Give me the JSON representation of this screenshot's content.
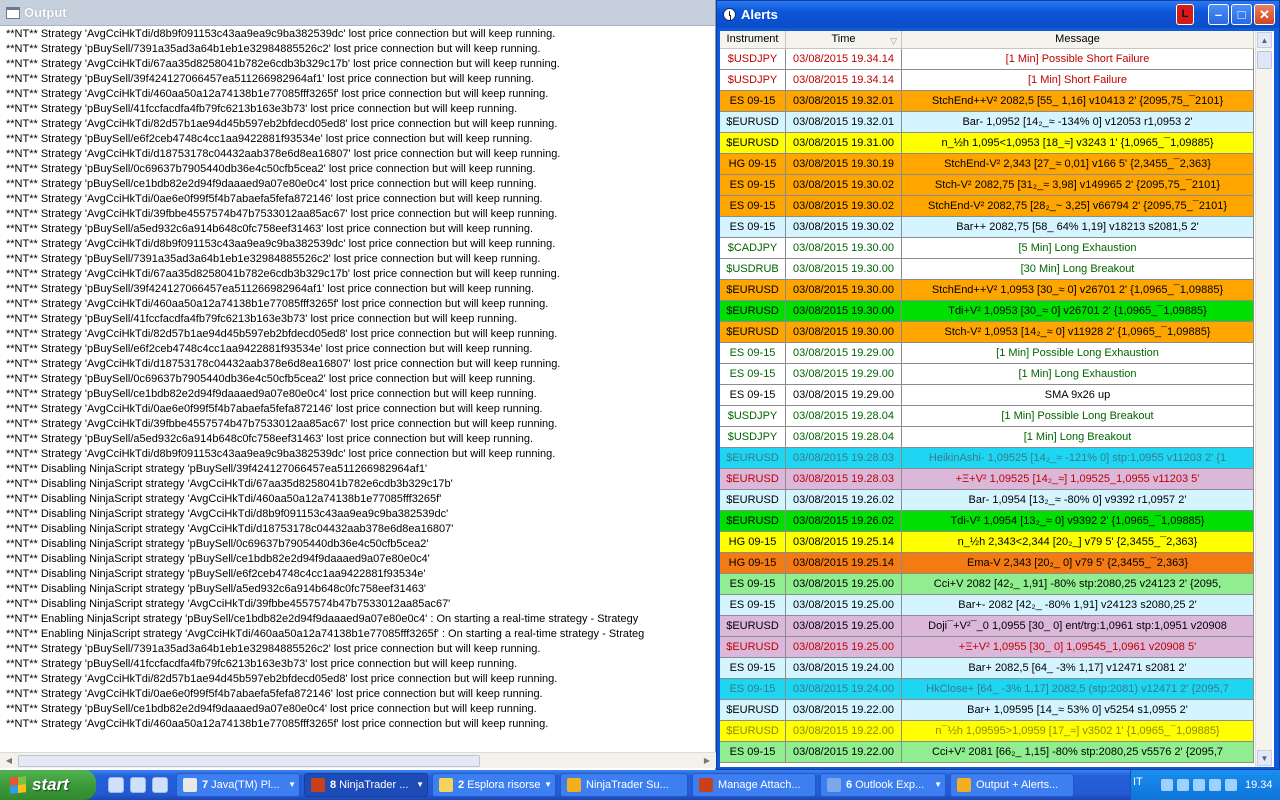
{
  "output": {
    "title": "Output",
    "lines": [
      "**NT** Strategy 'AvgCciHkTdi/d8b9f091153c43aa9ea9c9ba382539dc' lost price connection but will keep running.",
      "**NT** Strategy 'pBuySell/7391a35ad3a64b1eb1e32984885526c2' lost price connection but will keep running.",
      "**NT** Strategy 'AvgCciHkTdi/67aa35d8258041b782e6cdb3b329c17b' lost price connection but will keep running.",
      "**NT** Strategy 'pBuySell/39f424127066457ea511266982964af1' lost price connection but will keep running.",
      "**NT** Strategy 'AvgCciHkTdi/460aa50a12a74138b1e77085fff3265f' lost price connection but will keep running.",
      "**NT** Strategy 'pBuySell/41fccfacdfa4fb79fc6213b163e3b73' lost price connection but will keep running.",
      "**NT** Strategy 'AvgCciHkTdi/82d57b1ae94d45b597eb2bfdecd05ed8' lost price connection but will keep running.",
      "**NT** Strategy 'pBuySell/e6f2ceb4748c4cc1aa9422881f93534e' lost price connection but will keep running.",
      "**NT** Strategy 'AvgCciHkTdi/d18753178c04432aab378e6d8ea16807' lost price connection but will keep running.",
      "**NT** Strategy 'pBuySell/0c69637b7905440db36e4c50cfb5cea2' lost price connection but will keep running.",
      "**NT** Strategy 'pBuySell/ce1bdb82e2d94f9daaaed9a07e80e0c4' lost price connection but will keep running.",
      "**NT** Strategy 'AvgCciHkTdi/0ae6e0f99f5f4b7abaefa5fefa872146' lost price connection but will keep running.",
      "**NT** Strategy 'AvgCciHkTdi/39fbbe4557574b47b7533012aa85ac67' lost price connection but will keep running.",
      "**NT** Strategy 'pBuySell/a5ed932c6a914b648c0fc758eef31463' lost price connection but will keep running.",
      "**NT** Strategy 'AvgCciHkTdi/d8b9f091153c43aa9ea9c9ba382539dc' lost price connection but will keep running.",
      "**NT** Strategy 'pBuySell/7391a35ad3a64b1eb1e32984885526c2' lost price connection but will keep running.",
      "**NT** Strategy 'AvgCciHkTdi/67aa35d8258041b782e6cdb3b329c17b' lost price connection but will keep running.",
      "**NT** Strategy 'pBuySell/39f424127066457ea511266982964af1' lost price connection but will keep running.",
      "**NT** Strategy 'AvgCciHkTdi/460aa50a12a74138b1e77085fff3265f' lost price connection but will keep running.",
      "**NT** Strategy 'pBuySell/41fccfacdfa4fb79fc6213b163e3b73' lost price connection but will keep running.",
      "**NT** Strategy 'AvgCciHkTdi/82d57b1ae94d45b597eb2bfdecd05ed8' lost price connection but will keep running.",
      "**NT** Strategy 'pBuySell/e6f2ceb4748c4cc1aa9422881f93534e' lost price connection but will keep running.",
      "**NT** Strategy 'AvgCciHkTdi/d18753178c04432aab378e6d8ea16807' lost price connection but will keep running.",
      "**NT** Strategy 'pBuySell/0c69637b7905440db36e4c50cfb5cea2' lost price connection but will keep running.",
      "**NT** Strategy 'pBuySell/ce1bdb82e2d94f9daaaed9a07e80e0c4' lost price connection but will keep running.",
      "**NT** Strategy 'AvgCciHkTdi/0ae6e0f99f5f4b7abaefa5fefa872146' lost price connection but will keep running.",
      "**NT** Strategy 'AvgCciHkTdi/39fbbe4557574b47b7533012aa85ac67' lost price connection but will keep running.",
      "**NT** Strategy 'pBuySell/a5ed932c6a914b648c0fc758eef31463' lost price connection but will keep running.",
      "**NT** Strategy 'AvgCciHkTdi/d8b9f091153c43aa9ea9c9ba382539dc' lost price connection but will keep running.",
      "**NT** Disabling NinjaScript strategy 'pBuySell/39f424127066457ea511266982964af1'",
      "**NT** Disabling NinjaScript strategy 'AvgCciHkTdi/67aa35d8258041b782e6cdb3b329c17b'",
      "**NT** Disabling NinjaScript strategy 'AvgCciHkTdi/460aa50a12a74138b1e77085fff3265f'",
      "**NT** Disabling NinjaScript strategy 'AvgCciHkTdi/d8b9f091153c43aa9ea9c9ba382539dc'",
      "**NT** Disabling NinjaScript strategy 'AvgCciHkTdi/d18753178c04432aab378e6d8ea16807'",
      "**NT** Disabling NinjaScript strategy 'pBuySell/0c69637b7905440db36e4c50cfb5cea2'",
      "**NT** Disabling NinjaScript strategy 'pBuySell/ce1bdb82e2d94f9daaaed9a07e80e0c4'",
      "**NT** Disabling NinjaScript strategy 'pBuySell/e6f2ceb4748c4cc1aa9422881f93534e'",
      "**NT** Disabling NinjaScript strategy 'pBuySell/a5ed932c6a914b648c0fc758eef31463'",
      "**NT** Disabling NinjaScript strategy 'AvgCciHkTdi/39fbbe4557574b47b7533012aa85ac67'",
      "**NT** Enabling NinjaScript strategy 'pBuySell/ce1bdb82e2d94f9daaaed9a07e80e0c4' : On starting a real-time strategy - Strategy",
      "**NT** Enabling NinjaScript strategy 'AvgCciHkTdi/460aa50a12a74138b1e77085fff3265f' : On starting a real-time strategy - Strateg",
      "**NT** Strategy 'pBuySell/7391a35ad3a64b1eb1e32984885526c2' lost price connection but will keep running.",
      "**NT** Strategy 'pBuySell/41fccfacdfa4fb79fc6213b163e3b73' lost price connection but will keep running.",
      "**NT** Strategy 'AvgCciHkTdi/82d57b1ae94d45b597eb2bfdecd05ed8' lost price connection but will keep running.",
      "**NT** Strategy 'AvgCciHkTdi/0ae6e0f99f5f4b7abaefa5fefa872146' lost price connection but will keep running.",
      "**NT** Strategy 'pBuySell/ce1bdb82e2d94f9daaaed9a07e80e0c4' lost price connection but will keep running.",
      "**NT** Strategy 'AvgCciHkTdi/460aa50a12a74138b1e77085fff3265f' lost price connection but will keep running."
    ]
  },
  "alerts": {
    "title": "Alerts",
    "columns": {
      "instrument": "Instrument",
      "time": "Time",
      "message": "Message"
    },
    "rows": [
      {
        "instrument": "$USDJPY",
        "time": "03/08/2015 19.34.14",
        "message": "[1 Min] Possible Short Failure",
        "bg": "#ffffff",
        "fg": "#c00000"
      },
      {
        "instrument": "$USDJPY",
        "time": "03/08/2015 19.34.14",
        "message": "[1 Min] Short Failure",
        "bg": "#ffffff",
        "fg": "#c00000"
      },
      {
        "instrument": "ES 09-15",
        "time": "03/08/2015 19.32.01",
        "message": "StchEnd++V²   2082,5  [55_  1,16]   v10413  2'   {2095,75_¯2101}",
        "bg": "#ffa500",
        "fg": "#000000"
      },
      {
        "instrument": "$EURUSD",
        "time": "03/08/2015 19.32.01",
        "message": "Bar-   1,0952  [14₂_≈  -134%  0]   v12053  r1,0953  2'",
        "bg": "#d4f5ff",
        "fg": "#000000"
      },
      {
        "instrument": "$EURUSD",
        "time": "03/08/2015 19.31.00",
        "message": "n_½h   1,095<1,0953  [18_≈]   v3243  1'   {1,0965_¯1,09885}",
        "bg": "#ffff00",
        "fg": "#000000"
      },
      {
        "instrument": "HG 09-15",
        "time": "03/08/2015 19.30.19",
        "message": "StchEnd-V²   2,343  [27_≈  0,01]   v166  5'   {2,3455_¯2,363}",
        "bg": "#ffa500",
        "fg": "#000000"
      },
      {
        "instrument": "ES 09-15",
        "time": "03/08/2015 19.30.02",
        "message": "Stch-V²   2082,75  [31₂_≈  3,98]   v149965  2'   {2095,75_¯2101}",
        "bg": "#ffa500",
        "fg": "#000000"
      },
      {
        "instrument": "ES 09-15",
        "time": "03/08/2015 19.30.02",
        "message": "StchEnd-V²   2082,75  [28₂_~  3,25]   v66794  2'   {2095,75_¯2101}",
        "bg": "#ffa500",
        "fg": "#000000"
      },
      {
        "instrument": "ES 09-15",
        "time": "03/08/2015 19.30.02",
        "message": "Bar++   2082,75  [58_  64%  1,19]   v18213  s2081,5  2'",
        "bg": "#d4f5ff",
        "fg": "#000000"
      },
      {
        "instrument": "$CADJPY",
        "time": "03/08/2015 19.30.00",
        "message": "[5 Min] Long Exhaustion",
        "bg": "#ffffff",
        "fg": "#006400"
      },
      {
        "instrument": "$USDRUB",
        "time": "03/08/2015 19.30.00",
        "message": "[30 Min] Long Breakout",
        "bg": "#ffffff",
        "fg": "#006400"
      },
      {
        "instrument": "$EURUSD",
        "time": "03/08/2015 19.30.00",
        "message": "StchEnd++V²   1,0953  [30_≈  0]   v26701  2'   {1,0965_¯1,09885}",
        "bg": "#ffa500",
        "fg": "#000000"
      },
      {
        "instrument": "$EURUSD",
        "time": "03/08/2015 19.30.00",
        "message": "Tdi+V²   1,0953  [30_≈  0]   v26701  2'   {1,0965_¯1,09885}",
        "bg": "#00e000",
        "fg": "#000000"
      },
      {
        "instrument": "$EURUSD",
        "time": "03/08/2015 19.30.00",
        "message": "Stch-V²   1,0953  [14₂_≈  0]   v11928  2'   {1,0965_¯1,09885}",
        "bg": "#ffa500",
        "fg": "#000000"
      },
      {
        "instrument": "ES 09-15",
        "time": "03/08/2015 19.29.00",
        "message": "[1 Min] Possible Long Exhaustion",
        "bg": "#ffffff",
        "fg": "#006400"
      },
      {
        "instrument": "ES 09-15",
        "time": "03/08/2015 19.29.00",
        "message": "[1 Min] Long Exhaustion",
        "bg": "#ffffff",
        "fg": "#006400"
      },
      {
        "instrument": "ES 09-15",
        "time": "03/08/2015 19.29.00",
        "message": "SMA 9x26 up",
        "bg": "#ffffff",
        "fg": "#000000"
      },
      {
        "instrument": "$USDJPY",
        "time": "03/08/2015 19.28.04",
        "message": "[1 Min] Possible Long Breakout",
        "bg": "#ffffff",
        "fg": "#006400"
      },
      {
        "instrument": "$USDJPY",
        "time": "03/08/2015 19.28.04",
        "message": "[1 Min] Long Breakout",
        "bg": "#ffffff",
        "fg": "#006400"
      },
      {
        "instrument": "$EURUSD",
        "time": "03/08/2015 19.28.03",
        "message": "HeikinAshi-   1,09525  [14₂_≈  -121%  0]   stp:1,0955  v11203  2'   {1",
        "bg": "#1ed6f2",
        "fg": "#3a7a8a"
      },
      {
        "instrument": "$EURUSD",
        "time": "03/08/2015 19.28.03",
        "message": "+Ξ+V²   1,09525  [14₂_≈]   1,09525_1,0955   v11203  5'",
        "bg": "#dbb8da",
        "fg": "#c00000"
      },
      {
        "instrument": "$EURUSD",
        "time": "03/08/2015 19.26.02",
        "message": "Bar-   1,0954  [13₂_≈  -80%  0]   v9392  r1,0957  2'",
        "bg": "#d4f5ff",
        "fg": "#000000"
      },
      {
        "instrument": "$EURUSD",
        "time": "03/08/2015 19.26.02",
        "message": "Tdi-V²   1,0954  [13₂_≈  0]   v9392  2'   {1,0965_¯1,09885}",
        "bg": "#00e000",
        "fg": "#000000"
      },
      {
        "instrument": "HG 09-15",
        "time": "03/08/2015 19.25.14",
        "message": "n_½h   2,343<2,344  [20₂_]   v79  5'   {2,3455_¯2,363}",
        "bg": "#ffff00",
        "fg": "#000000"
      },
      {
        "instrument": "HG 09-15",
        "time": "03/08/2015 19.25.14",
        "message": "Ema-V   2,343  [20₂_  0]   v79  5'   {2,3455_¯2,363}",
        "bg": "#f47a14",
        "fg": "#000000"
      },
      {
        "instrument": "ES 09-15",
        "time": "03/08/2015 19.25.00",
        "message": "Cci+V   2082  [42₂_  1,91]  -80%   stp:2080,25   v24123  2'   {2095,",
        "bg": "#90ee90",
        "fg": "#000000"
      },
      {
        "instrument": "ES 09-15",
        "time": "03/08/2015 19.25.00",
        "message": "Bar+-   2082  [42₂_  -80%  1,91]   v24123  s2080,25  2'",
        "bg": "#d4f5ff",
        "fg": "#000000"
      },
      {
        "instrument": "$EURUSD",
        "time": "03/08/2015 19.25.00",
        "message": "Doji¯+V²¯_0   1,0955  [30_  0]   ent/trg:1,0961   stp:1,0951   v20908",
        "bg": "#dbb8da",
        "fg": "#000000"
      },
      {
        "instrument": "$EURUSD",
        "time": "03/08/2015 19.25.00",
        "message": "+Ξ+V²   1,0955  [30_  0]   1,09545_1,0961   v20908  5'",
        "bg": "#dbb8da",
        "fg": "#c00000"
      },
      {
        "instrument": "ES 09-15",
        "time": "03/08/2015 19.24.00",
        "message": "Bar+   2082,5  [64_  -3%  1,17]   v12471  s2081  2'",
        "bg": "#d4f5ff",
        "fg": "#000000"
      },
      {
        "instrument": "ES 09-15",
        "time": "03/08/2015 19.24.00",
        "message": "HkClose+  [64_  -3%  1,17]  2082,5  (stp:2081)  v12471  2'   {2095,7",
        "bg": "#1ed6f2",
        "fg": "#3a7a8a"
      },
      {
        "instrument": "$EURUSD",
        "time": "03/08/2015 19.22.00",
        "message": "Bar+   1,09595  [14_≈  53%  0]   v5254  s1,0955  2'",
        "bg": "#d4f5ff",
        "fg": "#000000"
      },
      {
        "instrument": "$EURUSD",
        "time": "03/08/2015 19.22.00",
        "message": "n¯½h   1,09595>1,0959  [17_≈]   v3502  1'   {1,0965_¯1,09885}",
        "bg": "#ffff00",
        "fg": "#8a8a00"
      },
      {
        "instrument": "ES 09-15",
        "time": "03/08/2015 19.22.00",
        "message": "Cci+V²   2081  [66₂_  1,15]  -80%   stp:2080,25   v5576  2'   {2095,7",
        "bg": "#90ee90",
        "fg": "#000000"
      }
    ]
  },
  "taskbar": {
    "start_label": "start",
    "tasks": [
      {
        "num": "7",
        "label": "Java(TM) Pl...",
        "icon_color": "#e8e8e8",
        "has_dd": true,
        "active": false
      },
      {
        "num": "8",
        "label": "NinjaTrader ...",
        "icon_color": "#c8401c",
        "has_dd": true,
        "active": true
      },
      {
        "num": "2",
        "label": "Esplora risorse",
        "icon_color": "#f5d25a",
        "has_dd": true,
        "active": false
      },
      {
        "num": "",
        "label": "NinjaTrader Su...",
        "icon_color": "#f2b020",
        "has_dd": false,
        "active": false
      },
      {
        "num": "",
        "label": "Manage Attach...",
        "icon_color": "#c8401c",
        "has_dd": false,
        "active": false
      },
      {
        "num": "6",
        "label": "Outlook Exp...",
        "icon_color": "#7aa8e8",
        "has_dd": true,
        "active": false
      },
      {
        "num": "",
        "label": "Output + Alerts...",
        "icon_color": "#f2b020",
        "has_dd": false,
        "active": false
      }
    ],
    "language": "IT",
    "clock": "19.34"
  }
}
